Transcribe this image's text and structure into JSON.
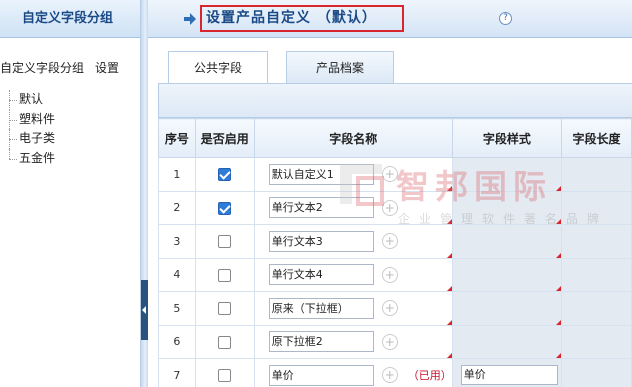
{
  "sidebar": {
    "title": "自定义字段分组",
    "root_label": "自定义字段分组",
    "settings_link": "设置",
    "items": [
      {
        "label": "默认"
      },
      {
        "label": "塑料件"
      },
      {
        "label": "电子类"
      },
      {
        "label": "五金件"
      }
    ]
  },
  "header": {
    "title": "设置产品自定义 （默认）",
    "help_icon": "question-circle-icon",
    "help_glyph": "?"
  },
  "tabs": [
    {
      "label": "公共字段",
      "active": true
    },
    {
      "label": "产品档案",
      "active": false
    }
  ],
  "table": {
    "columns": [
      "序号",
      "是否启用",
      "字段名称",
      "字段样式",
      "字段长度"
    ],
    "rows": [
      {
        "seq": "1",
        "enabled": true,
        "name": "默认自定义1",
        "used": "",
        "style": ""
      },
      {
        "seq": "2",
        "enabled": true,
        "name": "单行文本2",
        "used": "",
        "style": ""
      },
      {
        "seq": "3",
        "enabled": false,
        "name": "单行文本3",
        "used": "",
        "style": ""
      },
      {
        "seq": "4",
        "enabled": false,
        "name": "单行文本4",
        "used": "",
        "style": ""
      },
      {
        "seq": "5",
        "enabled": false,
        "name": "原来（下拉框）",
        "used": "",
        "style": ""
      },
      {
        "seq": "6",
        "enabled": false,
        "name": "原下拉框2",
        "used": "",
        "style": ""
      },
      {
        "seq": "7",
        "enabled": false,
        "name": "单价",
        "used": "（已用）",
        "style": "单价"
      }
    ],
    "add_glyph": "+"
  },
  "watermark": {
    "text": "智邦国际",
    "subtext": "企业管理软件著名品牌"
  },
  "colors": {
    "accent": "#1a4a86",
    "highlight_border": "#d8262e",
    "checkbox_on": "#2f7bd9",
    "used_text": "#c8102e"
  }
}
